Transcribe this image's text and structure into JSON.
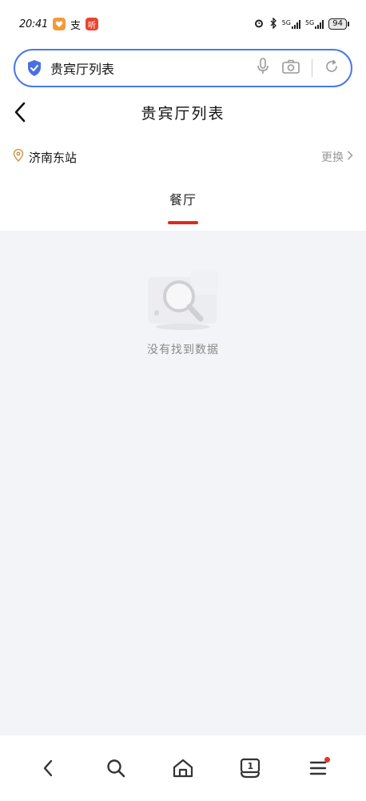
{
  "status_bar": {
    "time": "20:41",
    "app_badge_2": "支",
    "app_badge_3": "听",
    "network_1": "5G",
    "network_2": "5G",
    "battery": "94"
  },
  "search": {
    "query": "贵宾厅列表"
  },
  "header": {
    "title": "贵宾厅列表"
  },
  "location": {
    "station": "济南东站",
    "change_label": "更换"
  },
  "tabs": [
    {
      "label": "餐厅",
      "active": true
    }
  ],
  "empty_state": {
    "message": "没有找到数据"
  },
  "colors": {
    "accent_blue": "#4a78e8",
    "tab_indicator": "#e02a1c",
    "content_bg": "#f3f4f7",
    "badge_dot": "#e6322a"
  },
  "bottom_nav": {
    "tab_count": "1"
  }
}
